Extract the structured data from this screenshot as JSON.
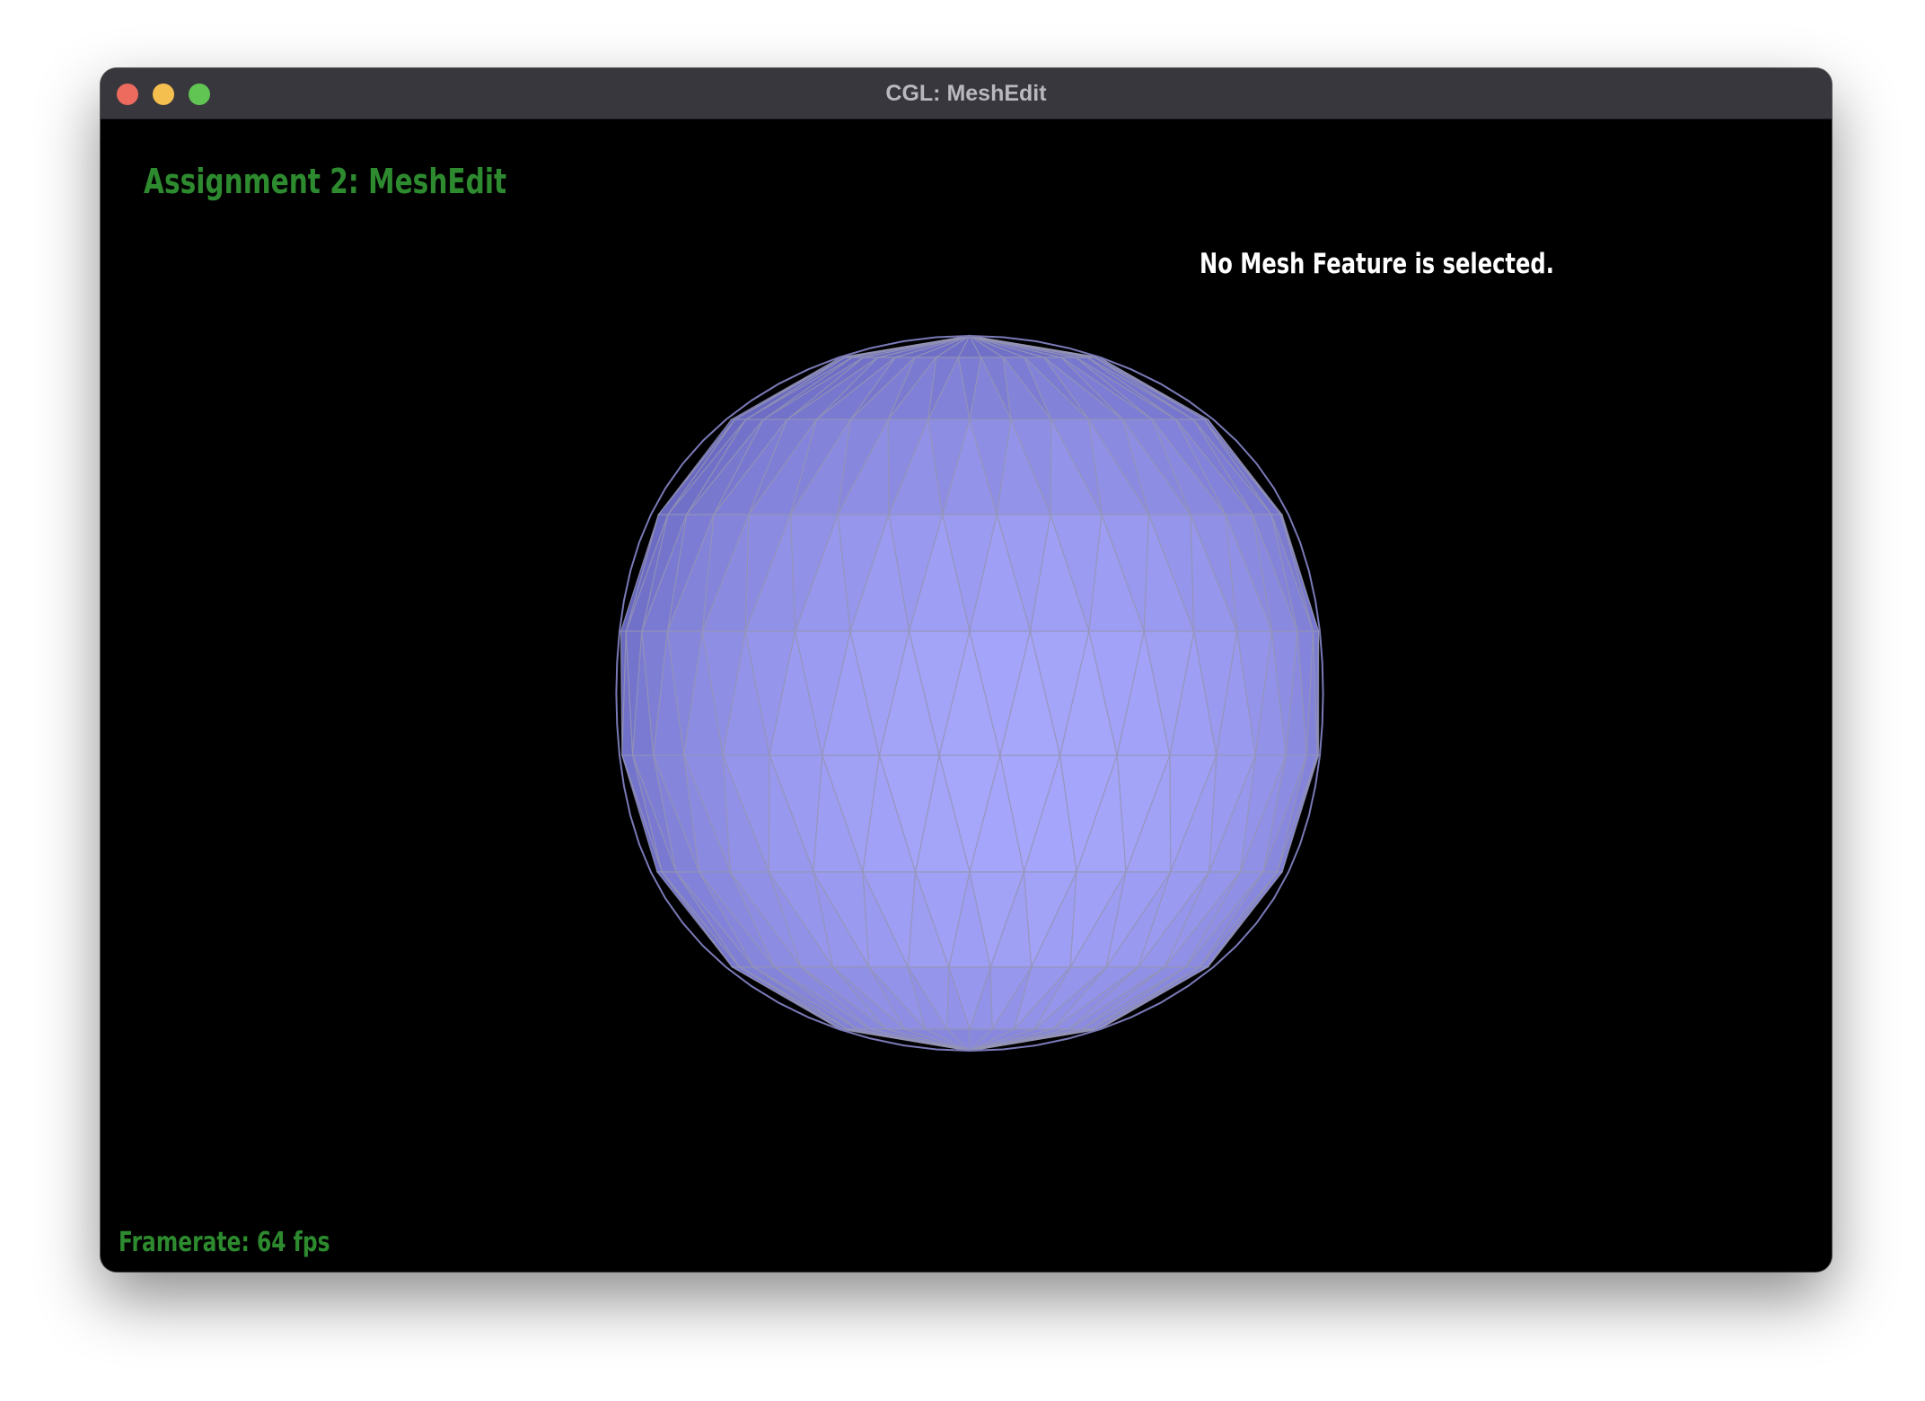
{
  "window": {
    "title": "CGL: MeshEdit"
  },
  "overlay": {
    "app_title": "Assignment 2: MeshEdit",
    "selection_info": "No Mesh Feature is selected.",
    "framerate": "Framerate: 64 fps"
  },
  "icons": {
    "close": "close-dot-icon",
    "minimize": "minimize-dot-icon",
    "zoom": "zoom-dot-icon"
  },
  "colors": {
    "title_bar": "#38373d",
    "title_text": "#b9b8bf",
    "viewport_background": "#000000",
    "hud_green": "#2d8a2e",
    "hud_white": "#ffffff",
    "mesh_fill_light": "#aaaaff",
    "mesh_fill_mid": "#8c8cf5",
    "mesh_fill_dark": "#5a5ab4",
    "mesh_edge": "#9696b4",
    "traffic_close": "#ed6a5e",
    "traffic_minimize": "#f5bf4f",
    "traffic_zoom": "#61c554"
  }
}
